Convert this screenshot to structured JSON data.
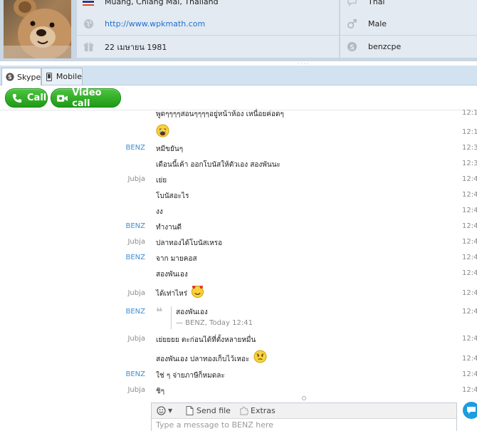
{
  "profile": {
    "location": "Muang, Chiang Mai, Thailand",
    "website": "http://www.wpkmath.com",
    "birthday": "22 เมษายน 1981",
    "language": "Thai",
    "gender": "Male",
    "skype_name": "benzcpe"
  },
  "tabs": [
    {
      "label": "Skype",
      "active": true
    },
    {
      "label": "Mobile",
      "active": false
    }
  ],
  "call_bar": {
    "call_label": "Call",
    "video_call_label": "Video call",
    "button_color": "#1e9a17"
  },
  "messages": [
    {
      "sender": "",
      "text": "พูดๆๆๆๆสอนๆๆๆๆอยู่หน้าห้อง เหนื่อยค่อดๆ",
      "time": "12:1"
    },
    {
      "sender": "",
      "text": "",
      "emoticon": "crying-face",
      "time": "12:1"
    },
    {
      "sender": "BENZ",
      "text": "หมีขยันๆ",
      "time": "12:3"
    },
    {
      "sender": "",
      "text": "เดือนนี้เค้า ออกโบนัสให้ตัวเอง สองพันนะ",
      "time": "12:3"
    },
    {
      "sender": "Jubja",
      "text": "เย่ย",
      "time": "12:4"
    },
    {
      "sender": "",
      "text": "โบนัสอะไร",
      "time": "12:4"
    },
    {
      "sender": "",
      "text": "งง",
      "time": "12:4"
    },
    {
      "sender": "BENZ",
      "text": "ทำงานดี",
      "time": "12:4"
    },
    {
      "sender": "Jubja",
      "text": "ปลาทองได้โบนัสเหรอ",
      "time": "12:4"
    },
    {
      "sender": "BENZ",
      "text": "จาก มายคอส",
      "time": "12:4"
    },
    {
      "sender": "",
      "text": "สองพันเอง",
      "time": "12:4"
    },
    {
      "sender": "Jubja",
      "text": "ได้เท่าไหร่",
      "emoticon": "in-love-face",
      "time": "12:4"
    },
    {
      "sender": "BENZ",
      "quote_text": "สองพันเอง",
      "quote_meta": "— BENZ, Today 12:41",
      "time": "12:4"
    },
    {
      "sender": "Jubja",
      "text": "เย่ยยยย ตะก่อนได้ที่ตั้งหลายหมื่น",
      "time": "12:4"
    },
    {
      "sender": "",
      "text": "สองพันเอง ปลาทองเก็บไว้เหอะ",
      "emoticon": "thinking-face",
      "time": "12:4"
    },
    {
      "sender": "BENZ",
      "text": "ใช่ ๆ จ่ายภาษีก็หมดละ",
      "time": "12:4"
    },
    {
      "sender": "Jubja",
      "text": "ชิๆ",
      "time": "12:4"
    }
  ],
  "compose": {
    "send_file_label": "Send file",
    "extras_label": "Extras",
    "placeholder": "Type a message to BENZ here"
  },
  "colors": {
    "sender_self": "#8b8b8b",
    "sender_contact": "#3a8fd6",
    "link": "#1f6fd1"
  }
}
